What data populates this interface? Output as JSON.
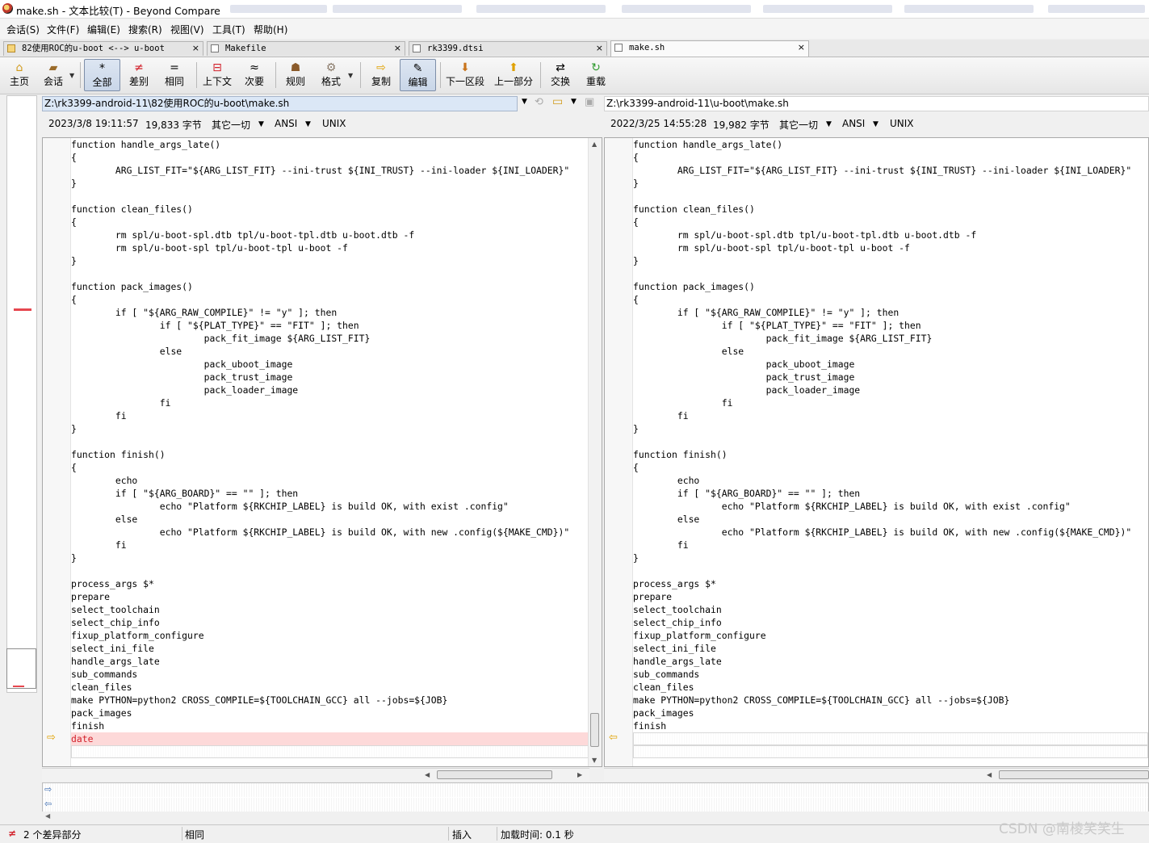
{
  "window": {
    "title": "make.sh - 文本比较(T) - Beyond Compare"
  },
  "menu": [
    "会话(S)",
    "文件(F)",
    "编辑(E)",
    "搜索(R)",
    "视图(V)",
    "工具(T)",
    "帮助(H)"
  ],
  "tabs": [
    {
      "label": "82使用ROC的u-boot <--> u-boot"
    },
    {
      "label": "Makefile"
    },
    {
      "label": "rk3399.dtsi"
    },
    {
      "label": "make.sh",
      "active": true
    }
  ],
  "toolbar": {
    "home": "主页",
    "session": "会话",
    "all": "全部",
    "diffs": "差别",
    "same": "相同",
    "context": "上下文",
    "minor": "次要",
    "rules": "规则",
    "format": "格式",
    "copy": "复制",
    "edit": "编辑",
    "next_section": "下一区段",
    "prev_section": "上一部分",
    "swap": "交换",
    "reload": "重载"
  },
  "left": {
    "path": "Z:\\rk3399-android-11\\82使用ROC的u-boot\\make.sh",
    "date": "2023/3/8 19:11:57",
    "size": "19,833 字节",
    "filter": "其它一切",
    "encoding": "ANSI",
    "line_ending": "UNIX"
  },
  "right": {
    "path": "Z:\\rk3399-android-11\\u-boot\\make.sh",
    "date": "2022/3/25 14:55:28",
    "size": "19,982 字节",
    "filter": "其它一切",
    "encoding": "ANSI",
    "line_ending": "UNIX"
  },
  "code_lines": [
    "function handle_args_late()",
    "{",
    "        ARG_LIST_FIT=\"${ARG_LIST_FIT} --ini-trust ${INI_TRUST} --ini-loader ${INI_LOADER}\"",
    "}",
    "",
    "function clean_files()",
    "{",
    "        rm spl/u-boot-spl.dtb tpl/u-boot-tpl.dtb u-boot.dtb -f",
    "        rm spl/u-boot-spl tpl/u-boot-tpl u-boot -f",
    "}",
    "",
    "function pack_images()",
    "{",
    "        if [ \"${ARG_RAW_COMPILE}\" != \"y\" ]; then",
    "                if [ \"${PLAT_TYPE}\" == \"FIT\" ]; then",
    "                        pack_fit_image ${ARG_LIST_FIT}",
    "                else",
    "                        pack_uboot_image",
    "                        pack_trust_image",
    "                        pack_loader_image",
    "                fi",
    "        fi",
    "}",
    "",
    "function finish()",
    "{",
    "        echo",
    "        if [ \"${ARG_BOARD}\" == \"\" ]; then",
    "                echo \"Platform ${RKCHIP_LABEL} is build OK, with exist .config\"",
    "        else",
    "                echo \"Platform ${RKCHIP_LABEL} is build OK, with new .config(${MAKE_CMD})\"",
    "        fi",
    "}",
    "",
    "process_args $*",
    "prepare",
    "select_toolchain",
    "select_chip_info",
    "fixup_platform_configure",
    "select_ini_file",
    "handle_args_late",
    "sub_commands",
    "clean_files",
    "make PYTHON=python2 CROSS_COMPILE=${TOOLCHAIN_GCC} all --jobs=${JOB}",
    "pack_images",
    "finish"
  ],
  "left_extra_line": "date",
  "status": {
    "diff_count": "2 个差异部分",
    "same": "相同",
    "insert": "插入",
    "load_time": "加载时间: 0.1 秒"
  },
  "watermark": "CSDN @南棱笑笑生",
  "colors": {
    "diff_bg": "#fdd9d9",
    "diff_text": "#d2212b",
    "path_highlight": "#dbe7f6"
  }
}
